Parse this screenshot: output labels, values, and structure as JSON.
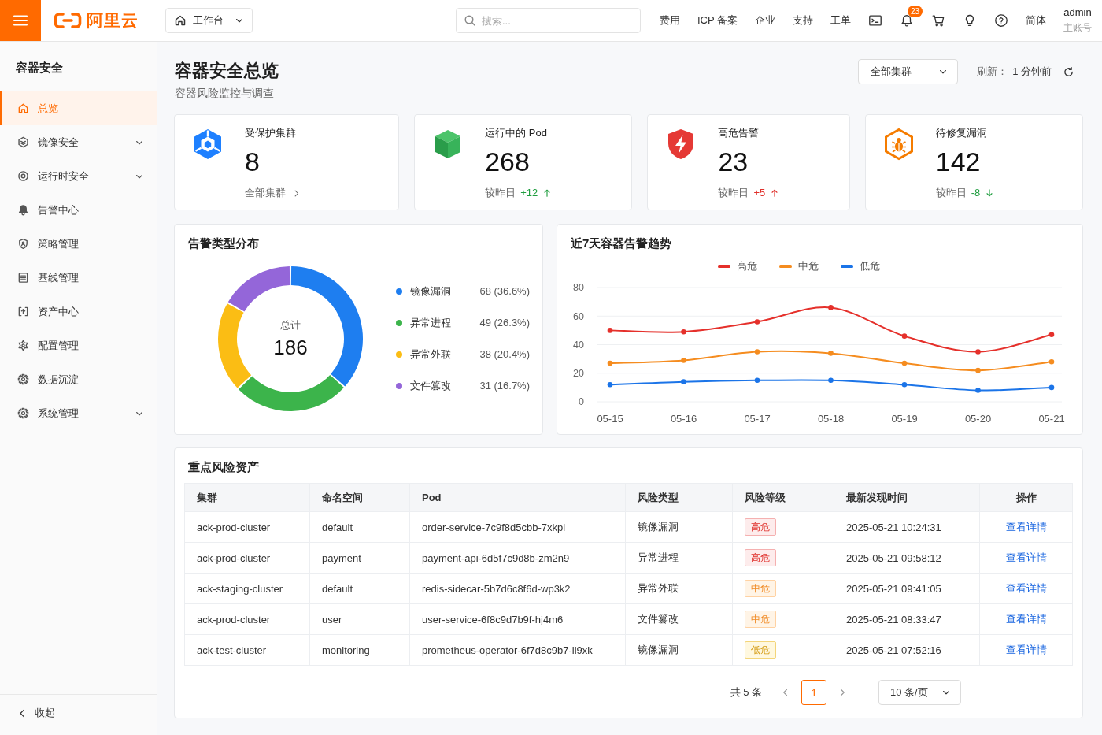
{
  "topbar": {
    "brand": "阿里云",
    "workspace": "工作台",
    "search": {
      "placeholder": "搜索..."
    },
    "nav": [
      "费用",
      "ICP 备案",
      "企业",
      "支持",
      "工单"
    ],
    "notification_count": "23",
    "language": "简体",
    "user": {
      "name": "admin",
      "role": "主账号"
    }
  },
  "sidebar": {
    "title": "容器安全",
    "items": [
      {
        "label": "总览",
        "selected": true,
        "expandable": false
      },
      {
        "label": "镜像安全",
        "selected": false,
        "expandable": true
      },
      {
        "label": "运行时安全",
        "selected": false,
        "expandable": true
      },
      {
        "label": "告警中心",
        "selected": false,
        "expandable": false
      },
      {
        "label": "策略管理",
        "selected": false,
        "expandable": false
      },
      {
        "label": "基线管理",
        "selected": false,
        "expandable": false
      },
      {
        "label": "资产中心",
        "selected": false,
        "expandable": false
      },
      {
        "label": "配置管理",
        "selected": false,
        "expandable": false
      },
      {
        "label": "数据沉淀",
        "selected": false,
        "expandable": false
      },
      {
        "label": "系统管理",
        "selected": false,
        "expandable": true
      }
    ],
    "collapse": "收起"
  },
  "page": {
    "title": "容器安全总览",
    "subtitle": "容器风险监控与调查",
    "cluster_filter": "全部集群",
    "refresh_label": "刷新：",
    "refresh_time": "1 分钟前"
  },
  "stats": [
    {
      "kind": "link",
      "label": "受保护集群",
      "value": "8",
      "link": "全部集群"
    },
    {
      "kind": "trend",
      "label": "运行中的 Pod",
      "value": "268",
      "compare": "较昨日",
      "delta": "+12",
      "rising": true,
      "color": "#1f9d3f"
    },
    {
      "kind": "trend",
      "label": "高危告警",
      "value": "23",
      "compare": "较昨日",
      "delta": "+5",
      "rising": true,
      "color": "#e0302b"
    },
    {
      "kind": "trend",
      "label": "待修复漏洞",
      "value": "142",
      "compare": "较昨日",
      "delta": "-8",
      "rising": false,
      "color": "#1f9d3f"
    }
  ],
  "alert_types": {
    "title": "告警类型分布",
    "total_label": "总计",
    "total": "186",
    "legend": [
      {
        "color": "#1e7ef0",
        "reading": "68 (36.6%)"
      },
      {
        "color": "#3cb44b",
        "reading": "49 (26.3%)"
      },
      {
        "color": "#fbbd14",
        "reading": "38 (20.4%)"
      },
      {
        "color": "#9466d9",
        "reading": "31 (16.7%)"
      }
    ],
    "chart_data": {
      "type": "donut",
      "categories": [
        "镜像漏洞",
        "异常进程",
        "异常外联",
        "文件篡改"
      ],
      "values": [
        36.6,
        26.3,
        20.4,
        16.7
      ]
    }
  },
  "trend": {
    "title": "近7天容器告警趋势",
    "chart_data": {
      "type": "line",
      "categories": [
        "05-15",
        "05-16",
        "05-17",
        "05-18",
        "05-19",
        "05-20",
        "05-21"
      ],
      "series": [
        {
          "name": "高危",
          "color": "#e5302b",
          "marker": "circle",
          "values": [
            50,
            49,
            56,
            66,
            46,
            35,
            47
          ]
        },
        {
          "name": "中危",
          "color": "#f58c1f",
          "marker": "circle",
          "values": [
            27,
            29,
            35,
            34,
            27,
            22,
            28
          ]
        },
        {
          "name": "低危",
          "color": "#1b74e8",
          "marker": "circle",
          "values": [
            12,
            14,
            15,
            15,
            12,
            8,
            10
          ]
        }
      ],
      "ylim": [
        0,
        80
      ],
      "yticks": [
        0,
        20,
        40,
        60,
        80
      ],
      "grid": true,
      "legend": true
    }
  },
  "assets": {
    "title": "重点风险资产",
    "columns": [
      "集群",
      "命名空间",
      "Pod",
      "风险类型",
      "风险等级",
      "最新发现时间",
      "操作"
    ],
    "rows": [
      {
        "cluster": "ack-prod-cluster",
        "namespace": "default",
        "pod": "order-service-7c9f8d5cbb-7xkpl",
        "risk_type": "镜像漏洞",
        "risk_level": {
          "label": "高危",
          "kind": "high"
        },
        "found_at": "2025-05-21 10:24:31",
        "action": "查看详情"
      },
      {
        "cluster": "ack-prod-cluster",
        "namespace": "payment",
        "pod": "payment-api-6d5f7c9d8b-zm2n9",
        "risk_type": "异常进程",
        "risk_level": {
          "label": "高危",
          "kind": "high"
        },
        "found_at": "2025-05-21 09:58:12",
        "action": "查看详情"
      },
      {
        "cluster": "ack-staging-cluster",
        "namespace": "default",
        "pod": "redis-sidecar-5b7d6c8f6d-wp3k2",
        "risk_type": "异常外联",
        "risk_level": {
          "label": "中危",
          "kind": "medium"
        },
        "found_at": "2025-05-21 09:41:05",
        "action": "查看详情"
      },
      {
        "cluster": "ack-prod-cluster",
        "namespace": "user",
        "pod": "user-service-6f8c9d7b9f-hj4m6",
        "risk_type": "文件篡改",
        "risk_level": {
          "label": "中危",
          "kind": "medium"
        },
        "found_at": "2025-05-21 08:33:47",
        "action": "查看详情"
      },
      {
        "cluster": "ack-test-cluster",
        "namespace": "monitoring",
        "pod": "prometheus-operator-6f7d8c9b7-ll9xk",
        "risk_type": "镜像漏洞",
        "risk_level": {
          "label": "低危",
          "kind": "low"
        },
        "found_at": "2025-05-21 07:52:16",
        "action": "查看详情"
      }
    ],
    "pagination": {
      "total": "共 5 条",
      "pages": [
        {
          "label": "1",
          "selected": true
        }
      ],
      "page_size": "10 条/页"
    }
  }
}
